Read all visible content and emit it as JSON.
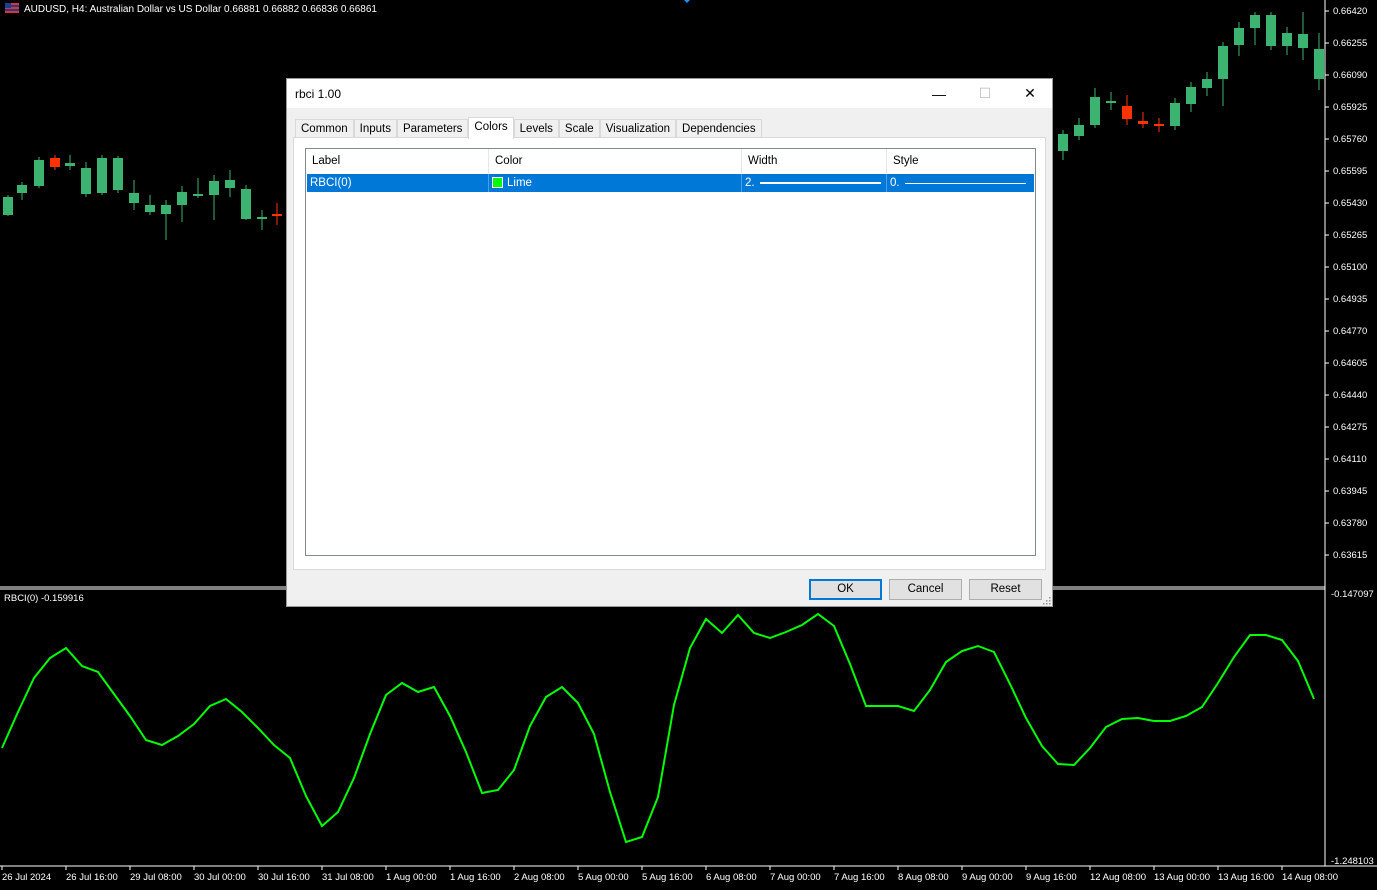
{
  "chart": {
    "symbol_line": "AUDUSD, H4:  Australian Dollar vs US Dollar  0.66881 0.66882 0.66836 0.66861",
    "price_axis": [
      "0.66420",
      "0.66255",
      "0.66090",
      "0.65925",
      "0.65760",
      "0.65595",
      "0.65430",
      "0.65265",
      "0.65100",
      "0.64935",
      "0.64770",
      "0.64605",
      "0.64440",
      "0.64275",
      "0.64110",
      "0.63945",
      "0.63780",
      "0.63615"
    ],
    "indicator_label": "RBCI(0) -0.159916",
    "indicator_axis_top": "-0.147097",
    "indicator_axis_bottom": "-1.248103",
    "time_axis": [
      "26 Jul 2024",
      "26 Jul 16:00",
      "29 Jul 08:00",
      "30 Jul 00:00",
      "30 Jul 16:00",
      "31 Jul 08:00",
      "1 Aug 00:00",
      "1 Aug 16:00",
      "2 Aug 08:00",
      "5 Aug 00:00",
      "5 Aug 16:00",
      "6 Aug 08:00",
      "7 Aug 00:00",
      "7 Aug 16:00",
      "8 Aug 08:00",
      "9 Aug 00:00",
      "9 Aug 16:00",
      "12 Aug 08:00",
      "13 Aug 00:00",
      "13 Aug 16:00",
      "14 Aug 08:00"
    ],
    "colors": {
      "bull": "#3cb371",
      "bear": "#ff3300",
      "indicator": "#00ff00",
      "separator": "#ffffff"
    }
  },
  "dialog": {
    "title": "rbci 1.00",
    "controls": {
      "minimize": "—",
      "maximize": "☐",
      "close": "✕"
    },
    "tabs": [
      "Common",
      "Inputs",
      "Parameters",
      "Colors",
      "Levels",
      "Scale",
      "Visualization",
      "Dependencies"
    ],
    "active_tab": "Colors",
    "columns": [
      "Label",
      "Color",
      "Width",
      "Style"
    ],
    "row": {
      "label": "RBCI(0)",
      "color_name": "Lime",
      "color_hex": "#00ff00",
      "width": "2.",
      "style": "0."
    },
    "buttons": {
      "ok": "OK",
      "cancel": "Cancel",
      "reset": "Reset"
    }
  }
}
